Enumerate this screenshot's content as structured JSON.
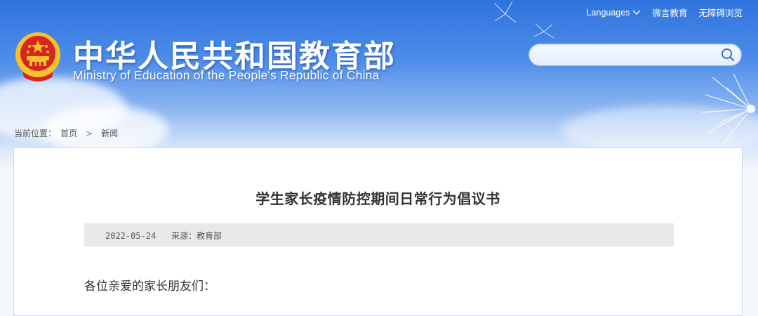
{
  "header": {
    "site_title": "中华人民共和国教育部",
    "site_subtitle": "Ministry of Education of the People's Republic of China",
    "top_links": {
      "languages": "Languages",
      "weixin": "微言教育",
      "accessibility": "无障碍浏览"
    },
    "search": {
      "value": "",
      "placeholder": ""
    }
  },
  "breadcrumb": {
    "prefix": "当前位置：",
    "home": "首页",
    "separator": ">",
    "current": "新闻"
  },
  "article": {
    "title": "学生家长疫情防控期间日常行为倡议书",
    "date": "2022-05-24",
    "source_label": "来源：",
    "source": "教育部",
    "salutation": "各位亲爱的家长朋友们："
  },
  "colors": {
    "banner_top": "#2f73dd",
    "banner_bottom": "#d8e7fa",
    "meta_bar": "#e8e8e8",
    "emblem_red": "#d7261e",
    "emblem_gold": "#f2c32c"
  },
  "icons": [
    "national-emblem",
    "chevron-down-icon",
    "search-icon",
    "dandelion-decoration"
  ]
}
